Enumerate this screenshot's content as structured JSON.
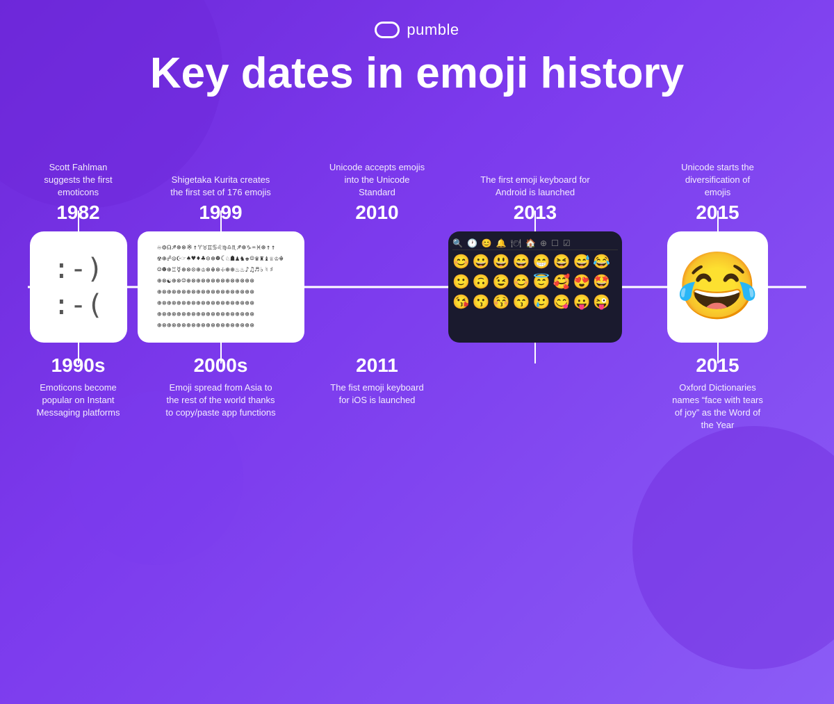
{
  "brand": {
    "logo_text": "pumble"
  },
  "page": {
    "title": "Key dates in emoji history"
  },
  "timeline": {
    "items_top": [
      {
        "id": "1982",
        "description": "Scott Fahlman suggests the first emoticons",
        "year": "1982"
      },
      {
        "id": "1999",
        "description": "Shigetaka Kurita creates the first set of 176 emojis",
        "year": "1999"
      },
      {
        "id": "2010",
        "description": "Unicode accepts emojis into the Unicode Standard",
        "year": "2010"
      },
      {
        "id": "2013",
        "description": "The first emoji keyboard for Android is launched",
        "year": "2013"
      },
      {
        "id": "2015top",
        "description": "Unicode starts the diversification of emojis",
        "year": "2015"
      }
    ],
    "items_bottom": [
      {
        "id": "1990s",
        "description": "Emoticons become popular on Instant Messaging platforms",
        "year": "1990s"
      },
      {
        "id": "2000s",
        "description": "Emoji spread from Asia to the rest of the world thanks to copy/paste app functions",
        "year": "2000s"
      },
      {
        "id": "2011",
        "description": "The fist emoji keyboard for iOS is launched",
        "year": "2011"
      },
      {
        "id": "2015bot",
        "description": "Oxford Dictionaries names “face with tears of joy” as the Word of the Year",
        "year": "2015"
      }
    ]
  }
}
